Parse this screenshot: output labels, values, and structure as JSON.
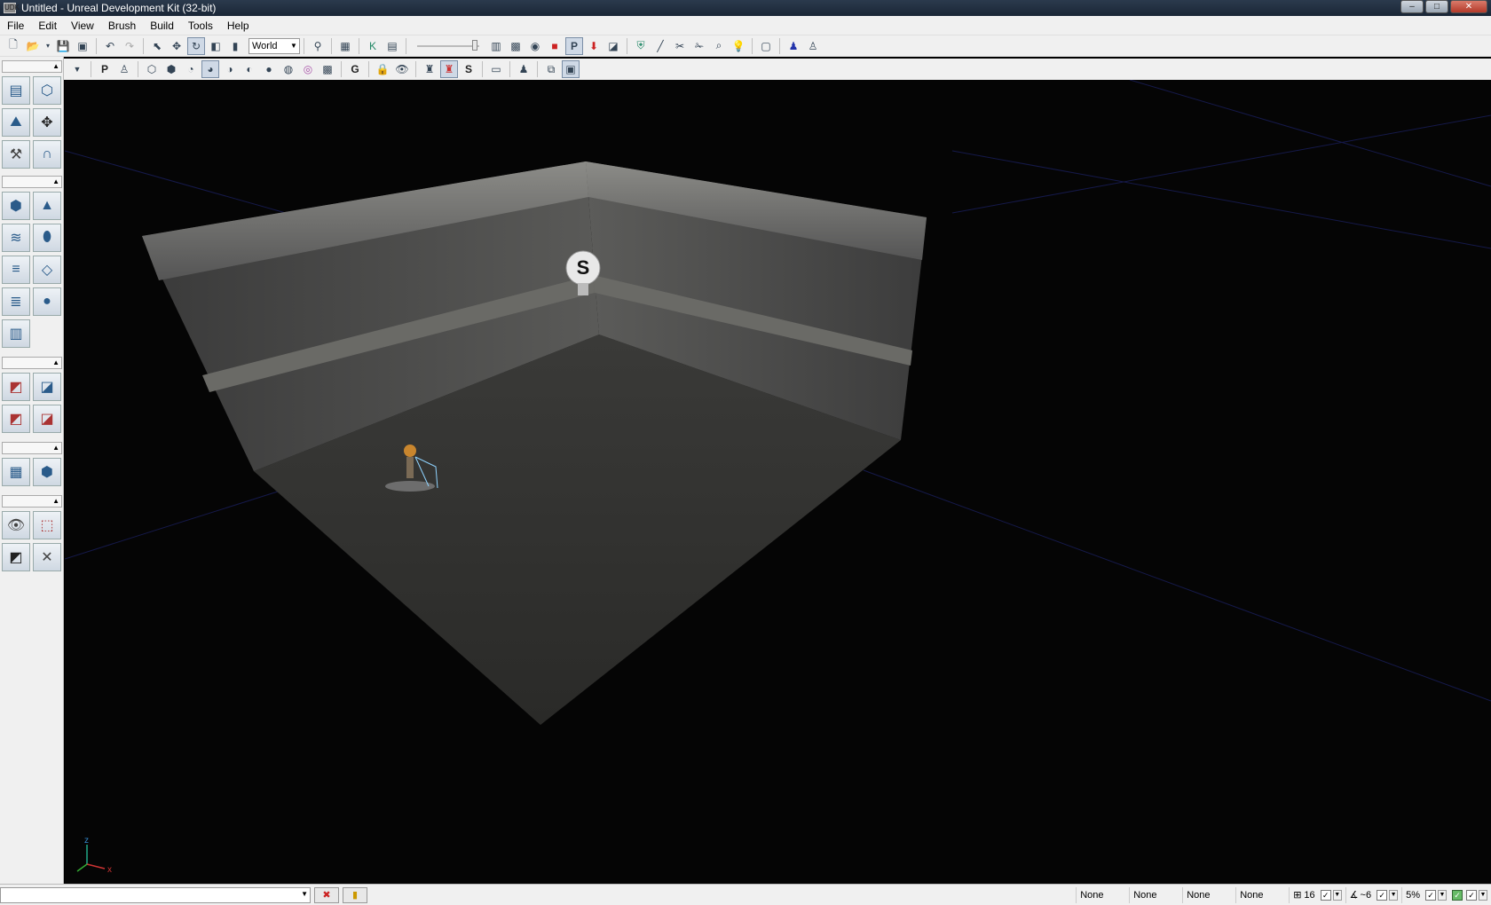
{
  "window": {
    "title": "Untitled - Unreal Development Kit (32-bit)",
    "app_icon": "UDK",
    "minimize": "–",
    "maximize": "□",
    "close": "✕"
  },
  "menu": [
    "File",
    "Edit",
    "View",
    "Brush",
    "Build",
    "Tools",
    "Help"
  ],
  "toolbar": {
    "coordinate_system": "World"
  },
  "viewport": {
    "light_label": "S",
    "axis_x": "x",
    "axis_z": "z"
  },
  "statusbar": {
    "fields": [
      "None",
      "None",
      "None",
      "None"
    ],
    "grid_size": "16",
    "rotation_snap": "~6",
    "scale_snap": "5%"
  },
  "icons": {
    "new": "new-file-icon",
    "open": "open-folder-icon",
    "save": "save-icon",
    "undo": "undo-icon",
    "redo": "redo-icon",
    "select": "select-icon",
    "translate": "translate-icon",
    "rotate": "rotate-icon",
    "camera_mode": "camera-mode-icon",
    "geometry_mode": "geometry-mode-icon"
  },
  "colors": {
    "accent": "#2a5b8a",
    "titlebar": "#1a2636",
    "viewport_bg": "#050505",
    "grid": "#1a1f5c"
  }
}
